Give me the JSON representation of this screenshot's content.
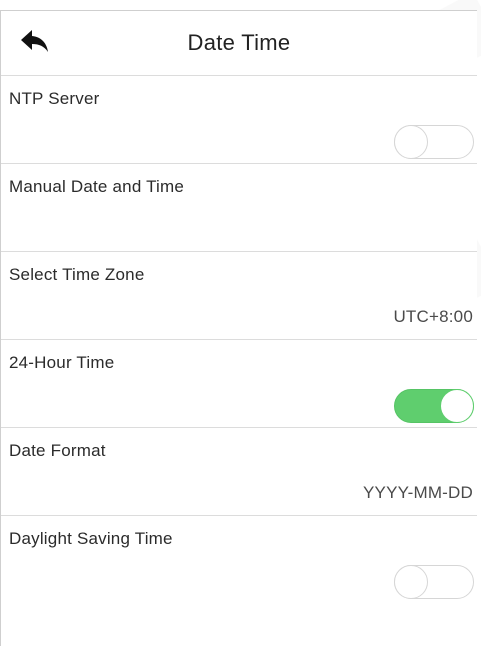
{
  "header": {
    "back_icon": "back-arrow-icon",
    "title": "Date Time"
  },
  "settings": [
    {
      "label": "NTP Server",
      "control": "toggle",
      "state": "off"
    },
    {
      "label": "Manual Date and Time",
      "control": "none"
    },
    {
      "label": "Select Time Zone",
      "control": "value",
      "value": "UTC+8:00"
    },
    {
      "label": "24-Hour Time",
      "control": "toggle",
      "state": "on"
    },
    {
      "label": "Date Format",
      "control": "value",
      "value": "YYYY-MM-DD"
    },
    {
      "label": "Daylight Saving Time",
      "control": "toggle",
      "state": "off"
    }
  ],
  "colors": {
    "toggle_on": "#5fce6e",
    "toggle_off_border": "#d6d6d6",
    "divider": "#dcdcdc"
  }
}
